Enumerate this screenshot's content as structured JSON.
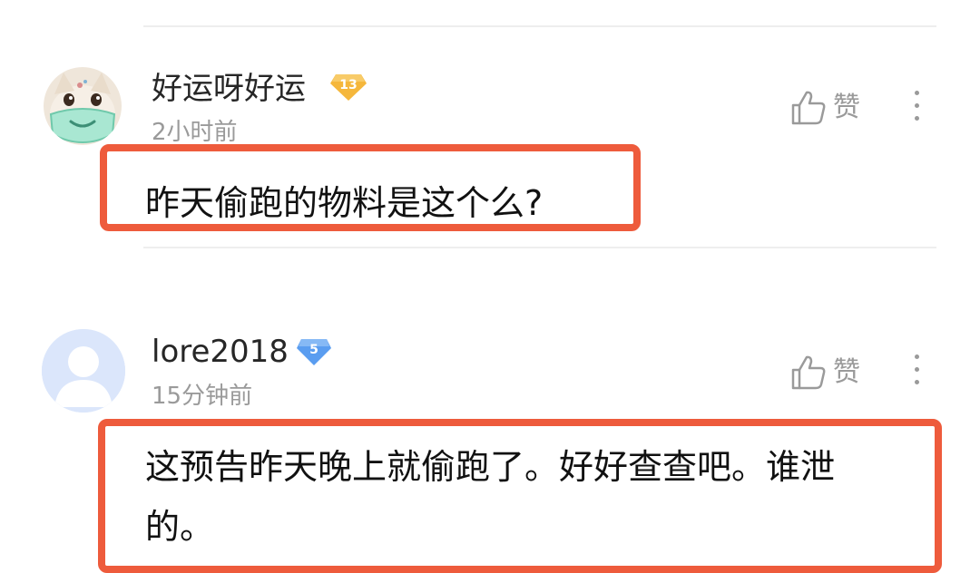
{
  "comments": [
    {
      "username": "好运呀好运",
      "level": "13",
      "time": "2小时前",
      "like_label": "赞",
      "text": "昨天偷跑的物料是这个么?",
      "colors": {
        "badge": "#f5b73c"
      }
    },
    {
      "username": "lore2018",
      "level": "5",
      "time": "15分钟前",
      "like_label": "赞",
      "text_line1": "这预告昨天晚上就偷跑了。好好查查吧。谁泄",
      "text_line2": "的。",
      "colors": {
        "badge": "#5a9df0"
      }
    }
  ],
  "colors": {
    "highlight": "#ee5b3c",
    "divider": "#eeeeee",
    "meta": "#9a9a9a"
  },
  "icons": [
    "thumbs-up-icon",
    "more-vertical-icon",
    "level-badge-icon",
    "default-avatar-icon"
  ]
}
